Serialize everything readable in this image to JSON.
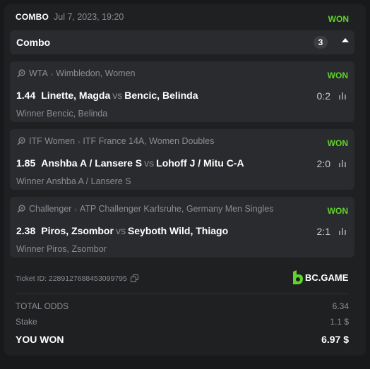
{
  "header": {
    "type_label": "COMBO",
    "date": "Jul 7, 2023, 19:20",
    "status": "WON"
  },
  "combo": {
    "title": "Combo",
    "count": "3"
  },
  "bets": [
    {
      "sport_icon": "tennis-icon",
      "category": "WTA",
      "tournament": "Wimbledon, Women",
      "status": "WON",
      "odds": "1.44",
      "home": "Linette, Magda",
      "vs": "vs",
      "away": "Bencic, Belinda",
      "score": "0:2",
      "pick": "Winner Bencic, Belinda"
    },
    {
      "sport_icon": "tennis-icon",
      "category": "ITF Women",
      "tournament": "ITF France 14A, Women Doubles",
      "status": "WON",
      "odds": "1.85",
      "home": "Anshba A / Lansere S",
      "vs": "vs",
      "away": "Lohoff J / Mitu C-A",
      "score": "2:0",
      "pick": "Winner Anshba A / Lansere S"
    },
    {
      "sport_icon": "tennis-icon",
      "category": "Challenger",
      "tournament": "ATP Challenger Karlsruhe, Germany Men Singles",
      "status": "WON",
      "odds": "2.38",
      "home": "Piros, Zsombor",
      "vs": "vs",
      "away": "Seyboth Wild, Thiago",
      "score": "2:1",
      "pick": "Winner Piros, Zsombor"
    }
  ],
  "ticket": {
    "label": "Ticket ID: 2289127688453099795"
  },
  "brand": {
    "name": "BC.GAME"
  },
  "summary": {
    "total_odds_label": "TOTAL ODDS",
    "total_odds": "6.34",
    "stake_label": "Stake",
    "stake": "1.1 $",
    "won_label": "YOU WON",
    "won": "6.97 $"
  },
  "colors": {
    "won": "#5fd32b",
    "background": "#18191b",
    "card": "#1f2022",
    "panel": "#2a2b2e",
    "muted": "#8a8d93"
  }
}
